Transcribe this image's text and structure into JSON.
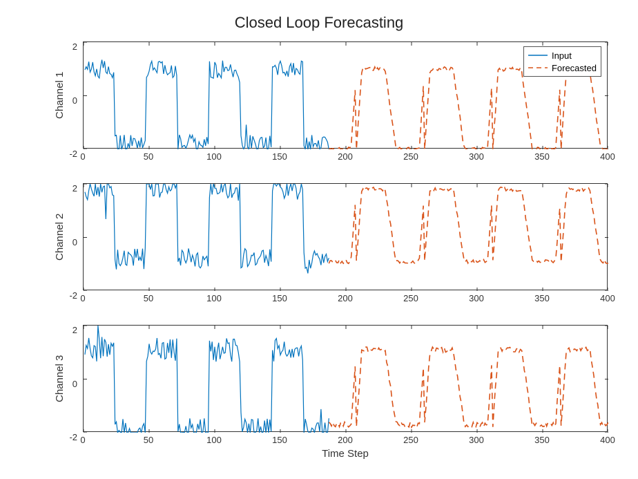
{
  "chart_data": [
    {
      "type": "line",
      "title": "Closed Loop Forecasting",
      "ylabel": "Channel 1",
      "xlim": [
        0,
        400
      ],
      "ylim": [
        -2,
        2
      ],
      "xticks": [
        0,
        50,
        100,
        150,
        200,
        250,
        300,
        350,
        400
      ],
      "yticks": [
        -2,
        0,
        2
      ],
      "series": [
        {
          "name": "Input",
          "color": "#0072BD",
          "dash": "solid",
          "x_range": [
            1,
            187
          ],
          "pattern": "noisy_square_wave",
          "low": -1.8,
          "high": 1.0,
          "period": 48,
          "noise": 0.35
        },
        {
          "name": "Forecasted",
          "color": "#D95319",
          "dash": "dash",
          "x_range": [
            187,
            400
          ],
          "pattern": "smooth_square_wave",
          "low": -2.0,
          "high": 1.0,
          "period": 52,
          "noise": 0.08
        }
      ],
      "legend": {
        "show": true,
        "entries": [
          "Input",
          "Forecasted"
        ]
      }
    },
    {
      "type": "line",
      "ylabel": "Channel 2",
      "xlim": [
        0,
        400
      ],
      "ylim": [
        -2,
        2
      ],
      "xticks": [
        0,
        50,
        100,
        150,
        200,
        250,
        300,
        350,
        400
      ],
      "yticks": [
        -2,
        0,
        2
      ],
      "series": [
        {
          "name": "Input",
          "color": "#0072BD",
          "dash": "solid",
          "x_range": [
            1,
            187
          ],
          "pattern": "noisy_square_wave",
          "low": -0.8,
          "high": 1.8,
          "period": 48,
          "noise": 0.4,
          "phase": 0
        },
        {
          "name": "Forecasted",
          "color": "#D95319",
          "dash": "dash",
          "x_range": [
            187,
            400
          ],
          "pattern": "smooth_square_wave",
          "low": -0.9,
          "high": 1.8,
          "period": 52,
          "noise": 0.08
        }
      ]
    },
    {
      "type": "line",
      "ylabel": "Channel 3",
      "xlabel": "Time Step",
      "xlim": [
        0,
        400
      ],
      "ylim": [
        -2,
        2
      ],
      "xticks": [
        0,
        50,
        100,
        150,
        200,
        250,
        300,
        350,
        400
      ],
      "yticks": [
        -2,
        0,
        2
      ],
      "series": [
        {
          "name": "Input",
          "color": "#0072BD",
          "dash": "solid",
          "x_range": [
            1,
            187
          ],
          "pattern": "noisy_square_wave",
          "low": -1.9,
          "high": 1.1,
          "period": 48,
          "noise": 0.45
        },
        {
          "name": "Forecasted",
          "color": "#D95319",
          "dash": "dash",
          "x_range": [
            187,
            400
          ],
          "pattern": "smooth_square_wave",
          "low": -1.7,
          "high": 1.1,
          "period": 52,
          "noise": 0.1
        }
      ]
    }
  ],
  "title": "Closed Loop Forecasting",
  "legend_labels": {
    "input": "Input",
    "forecasted": "Forecasted"
  },
  "colors": {
    "input": "#0072BD",
    "forecasted": "#D95319"
  }
}
